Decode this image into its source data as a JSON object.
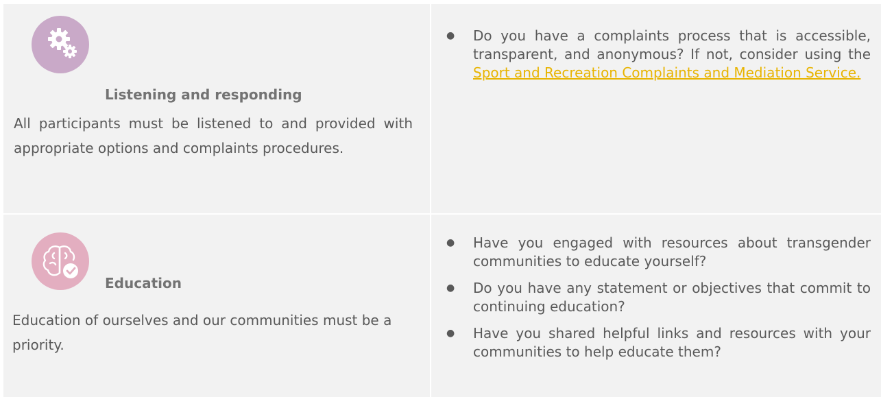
{
  "rows": [
    {
      "heading": "Listening and responding",
      "icon": "gears-icon",
      "icon_color": "#c9a9c8",
      "description": "All participants must be listened to and provided with appropriate options and complaints procedures.",
      "question_text": "Do you have a complaints process that is accessible, transparent, and anonymous? If not, consider using the",
      "question_link": "Sport and Recreation Complaints and Mediation Service."
    },
    {
      "heading": "Education",
      "icon": "brain-check-icon",
      "icon_color": "#e3aec0",
      "description": "Education of ourselves and our communities must be a priority.",
      "questions": [
        "Have you engaged with resources about transgender communities to educate yourself?",
        "Do you have any statement or objectives that commit to continuing education?",
        "Have you shared helpful links and resources with your communities to help educate them?"
      ]
    }
  ],
  "colors": {
    "cell_bg": "#f2f2f2",
    "text": "#595959",
    "link": "#e8b400"
  }
}
